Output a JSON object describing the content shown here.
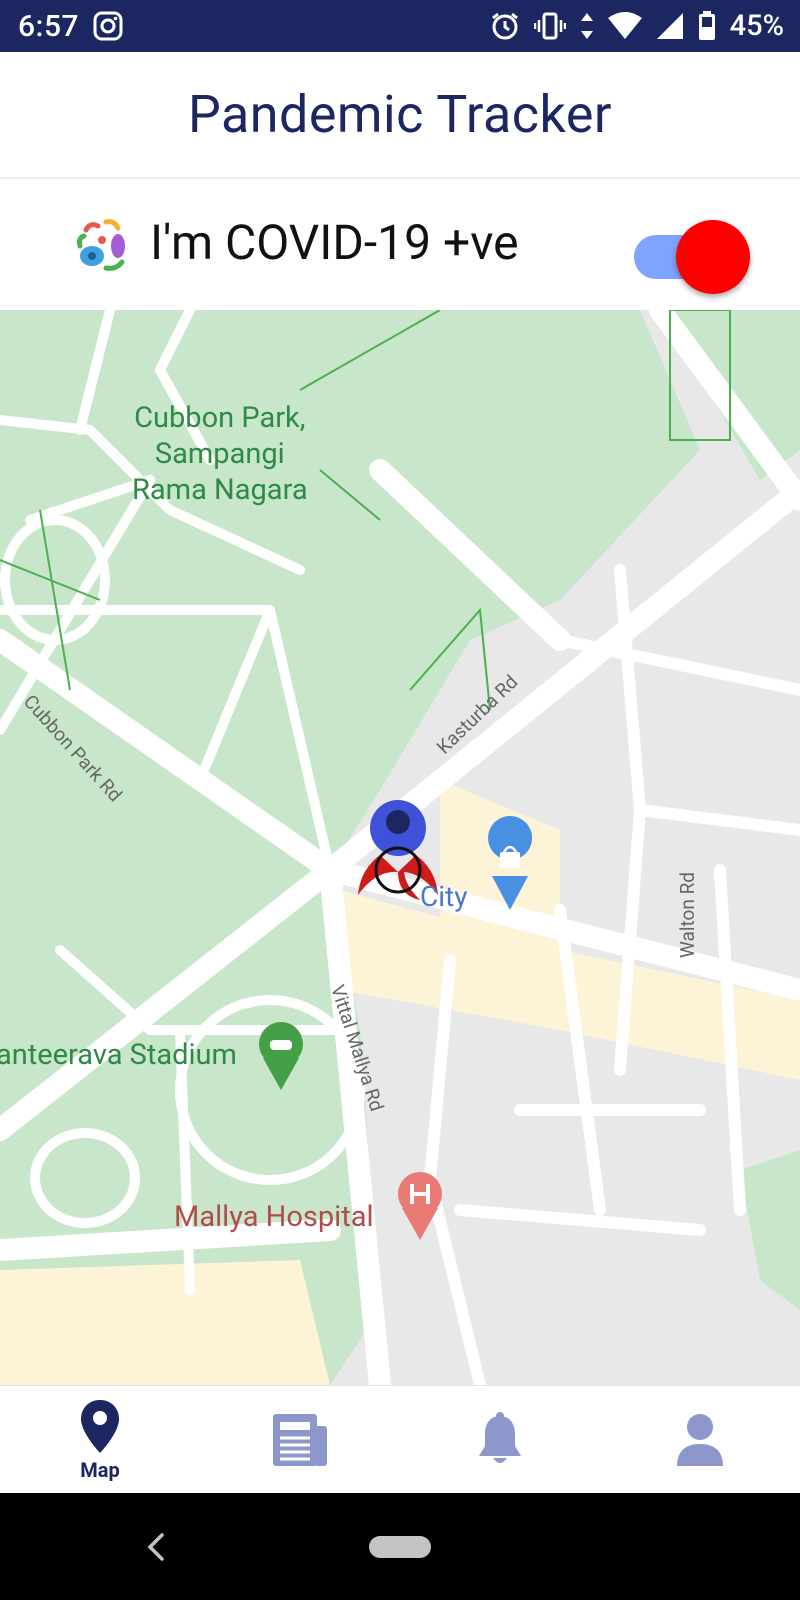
{
  "status_bar": {
    "time": "6:57",
    "battery_percent": "45%",
    "icons": [
      "instagram-icon",
      "alarm-icon",
      "vibrate-icon",
      "data-arrows-icon",
      "wifi-icon",
      "signal-icon",
      "battery-icon"
    ]
  },
  "header": {
    "title": "Pandemic Tracker"
  },
  "covid_status": {
    "label": "I'm COVID-19 +ve",
    "icon": "virus-icon",
    "toggle_on": true,
    "toggle_thumb_color": "#ff0000",
    "toggle_track_color": "#7fa4ff"
  },
  "map": {
    "places": {
      "park_line1": "Cubbon Park,",
      "park_line2": "Sampangi",
      "park_line3": "Rama Nagara",
      "stadium": "anteerava Stadium",
      "hospital": "Mallya Hospital",
      "mall": "City"
    },
    "roads": {
      "cubbon_park_rd": "Cubbon Park Rd",
      "kasturba_rd": "Kasturba Rd",
      "vittal_mallya_rd": "Vittal Mallya Rd",
      "walton_rd": "Walton Rd"
    },
    "colors": {
      "park_green": "#c8e6c9",
      "road": "#ffffff",
      "urban": "#e8e8e8",
      "commercial": "#fdf3d6"
    },
    "markers": [
      "biohazard-marker-icon",
      "shopping-bag-pin-icon",
      "stadium-pin-icon",
      "hospital-pin-icon"
    ]
  },
  "bottom_nav": {
    "active": "map",
    "items": [
      {
        "id": "map",
        "label": "Map",
        "icon": "map-pin-icon"
      },
      {
        "id": "news",
        "label": "",
        "icon": "newspaper-icon"
      },
      {
        "id": "alerts",
        "label": "",
        "icon": "bell-icon"
      },
      {
        "id": "profile",
        "label": "",
        "icon": "user-icon"
      }
    ],
    "active_color": "#1c2661",
    "inactive_color": "#8e97cc"
  }
}
